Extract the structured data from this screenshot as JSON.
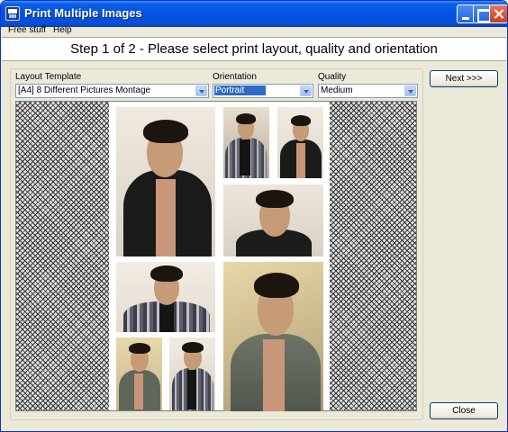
{
  "window": {
    "title": "Print Multiple Images"
  },
  "menu": {
    "items": [
      {
        "label": "Free stuff"
      },
      {
        "label": "Help"
      }
    ]
  },
  "header": {
    "step_text": "Step 1 of 2 - Please select print layout, quality and orientation"
  },
  "layout_template": {
    "label": "Layout Template",
    "value": "[A4] 8 Different Pictures Montage"
  },
  "orientation": {
    "label": "Orientation",
    "value": "Portrait"
  },
  "quality": {
    "label": "Quality",
    "value": "Medium"
  },
  "buttons": {
    "next": "Next >>>",
    "close": "Close"
  },
  "colors": {
    "title_bar": "#0054e3",
    "selection": "#316ac5",
    "face": "#ece9d8"
  }
}
